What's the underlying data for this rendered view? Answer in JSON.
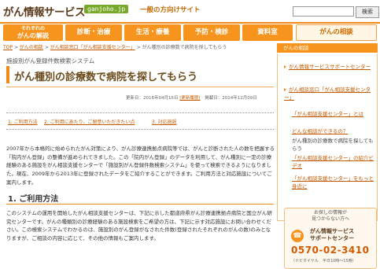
{
  "header": {
    "logo": "がん情報サービス",
    "domain": "ganjoho.jp",
    "tagline": "一般の方向けサイト",
    "search_button": "検索"
  },
  "nav": {
    "tabs": [
      {
        "label_line1": "それぞれの",
        "label_line2": "がんの解説"
      },
      {
        "label": "診断・治療"
      },
      {
        "label": "生活・療養"
      },
      {
        "label": "予防・検診"
      },
      {
        "label": "資料室"
      },
      {
        "label": "がんの相談"
      }
    ]
  },
  "breadcrumb": {
    "items": [
      "TOP",
      "がんの相談",
      "がん相談窓口「がん相談支援センター」",
      "がん種別の診療数で病院を探してもらう"
    ],
    "sep": ">"
  },
  "main": {
    "subtitle": "施設別がん登録件数検索システム",
    "title": "がん種別の診療数で病院を探してもらう",
    "updated_label": "更新日：2016年04月15日",
    "history_link": "[更新履歴]",
    "published_label": "掲載日：2014年12月09日",
    "toc": [
      "1. ご利用方法",
      "2. ご利用にあたり、ご留意いただきたい点",
      "3. 対応施設"
    ],
    "intro": "2007年から本格的に始められたがん対策により、がん診療連携拠点病院等では、がんと診断された人の数を把握する「院内がん登録」の整備が進められてきました。この「院内がん登録」のデータを利用して、がん種別に一定の診療経験のある施設をがん相談支援センターで「施設別がん登録件数検索システム」を使って検索できるようになりました。現在、2009年から2013年に登録されたデータをご紹介することができます。ご利用方法と対応施設についてご案内します。",
    "section1_title": "1. ご利用方法",
    "section1_text": "このシステムの運用を開始したがん相談支援センターは、下記に示した都道府県がん診療連携拠点病院と国立がん研究センターです。がんの種類別の診療経験のある施設検索をご希望の方は、下記に示す対応施設にお問い合わせください。この検索システムでわかるのは、施設別のがん登録がなされた件数(登録されたそれぞれのがんの数)のみとなりますが、ご相談の内容に応じて、その他の情報もご案内します。"
  },
  "sidebar": {
    "heading": "がんの相談",
    "items": [
      "がん情報サービスサポートセンター",
      "がん相談窓口「がん相談支援センター」",
      "「がん相談支援センター」とは",
      "どんな相談ができるの？",
      "がん種別の診療数で病院を探してもらう",
      "「がん相談支援センター」の紹介ビデオ",
      "「がん相談支援センター」をもっと身近に"
    ],
    "selected_index": 4,
    "help_text_line1": "お探しの情報が",
    "help_text_line2": "見つからない方へ",
    "support_line1": "がん情報サービス",
    "support_line2": "サポートセンター",
    "phone": "0570-02-3410",
    "hours": "（ナビダイヤル　平日10時～15時）"
  },
  "colors": {
    "accent": "#f7941d",
    "link": "#c45a00",
    "title_text": "#6a4a1a"
  },
  "icons": [
    "phone-icon"
  ]
}
